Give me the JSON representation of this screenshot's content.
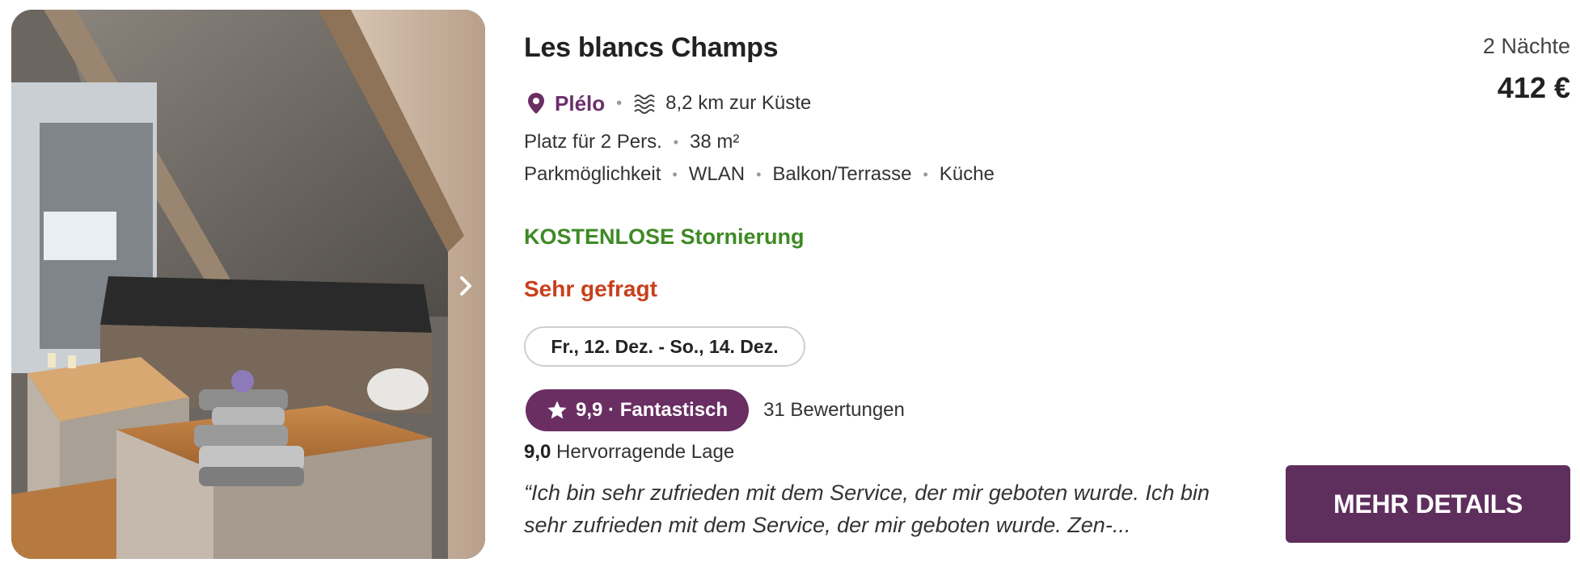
{
  "listing": {
    "title": "Les blancs Champs",
    "location": {
      "city": "Plélo",
      "coast_distance": "8,2 km zur Küste",
      "pin_icon": "map-pin-icon",
      "coast_icon": "waves-icon"
    },
    "capacity": "Platz für 2 Pers.",
    "size": "38 m²",
    "amenities": [
      "Parkmöglichkeit",
      "WLAN",
      "Balkon/Terrasse",
      "Küche"
    ],
    "cancellation": "KOSTENLOSE Stornierung",
    "demand": "Sehr gefragt",
    "dates": "Fr., 12. Dez. - So., 14. Dez.",
    "rating": {
      "label": "9,9 · Fantastisch",
      "reviews": "31 Bewertungen",
      "location_score": "9,0",
      "location_label": "Hervorragende Lage"
    },
    "review_quote": "“Ich bin sehr zufrieden mit dem Service, der mir geboten wurde. Ich bin sehr zufrieden mit dem Service, der mir geboten wurde. Zen-...",
    "nights": "2 Nächte",
    "price": "412 €",
    "cta": "MEHR DETAILS"
  },
  "colors": {
    "brand_purple": "#6a2e63",
    "cta_purple": "#5e2e5c",
    "cancellation_green": "#3e8a24",
    "demand_orange": "#c8401c"
  }
}
